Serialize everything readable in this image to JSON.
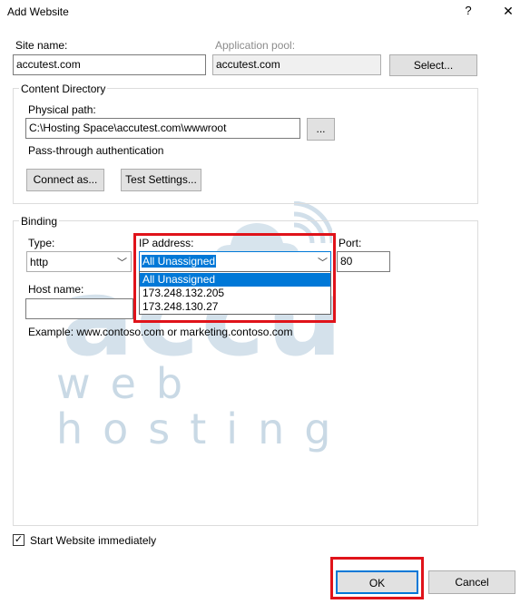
{
  "window": {
    "title": "Add Website",
    "help_glyph": "?",
    "close_glyph": "✕"
  },
  "site": {
    "site_name_label": "Site name:",
    "site_name_value": "accutest.com",
    "app_pool_label": "Application pool:",
    "app_pool_value": "accutest.com",
    "select_button": "Select..."
  },
  "content_directory": {
    "title": "Content Directory",
    "physical_path_label": "Physical path:",
    "physical_path_value": "C:\\Hosting Space\\accutest.com\\wwwroot",
    "browse_button": "...",
    "passthrough_label": "Pass-through authentication",
    "connect_button": "Connect as...",
    "test_button": "Test Settings..."
  },
  "binding": {
    "title": "Binding",
    "type_label": "Type:",
    "type_value": "http",
    "ip_label": "IP address:",
    "ip_value": "All Unassigned",
    "ip_options": [
      "All Unassigned",
      "173.248.132.205",
      "173.248.130.27"
    ],
    "port_label": "Port:",
    "port_value": "80",
    "host_label": "Host name:",
    "host_value": "",
    "example_text": "Example: www.contoso.com or marketing.contoso.com"
  },
  "watermark": {
    "main": "accu",
    "sub": "web hosting"
  },
  "footer": {
    "start_label": "Start Website immediately",
    "start_checked": true,
    "ok_button": "OK",
    "cancel_button": "Cancel"
  },
  "colors": {
    "highlight": "#e0131a",
    "selection": "#0078d7",
    "accent_border": "#0078d7"
  }
}
